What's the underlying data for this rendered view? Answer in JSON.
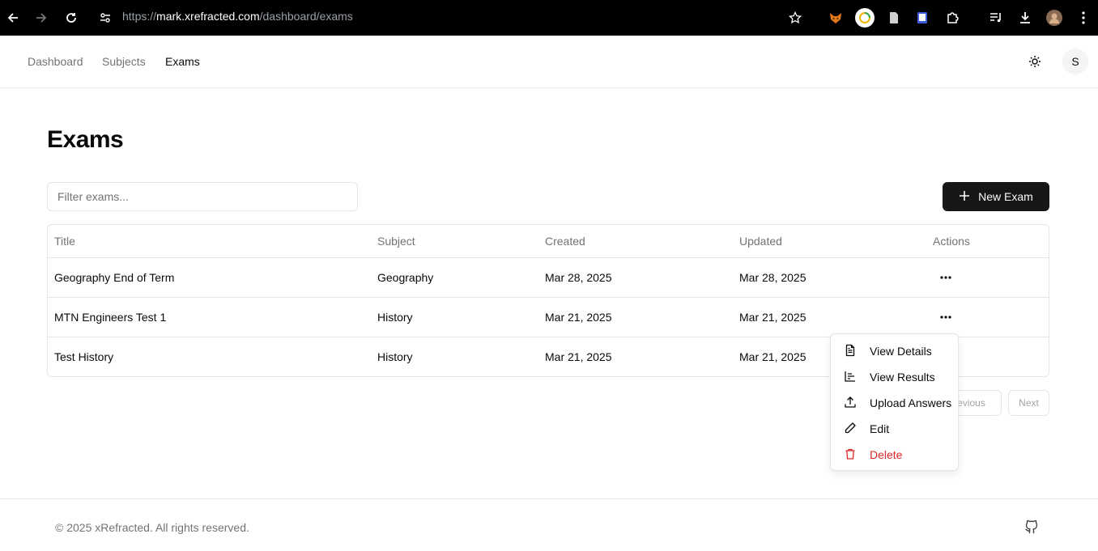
{
  "browser": {
    "url_prefix": "https://",
    "url_domain": "mark.xrefracted.com",
    "url_path": "/dashboard/exams"
  },
  "nav": {
    "links": [
      {
        "label": "Dashboard",
        "active": false
      },
      {
        "label": "Subjects",
        "active": false
      },
      {
        "label": "Exams",
        "active": true
      }
    ],
    "avatar_initial": "S"
  },
  "page": {
    "title": "Exams",
    "filter_placeholder": "Filter exams...",
    "new_button_label": "New Exam"
  },
  "table": {
    "headers": [
      "Title",
      "Subject",
      "Created",
      "Updated",
      "Actions"
    ],
    "rows": [
      {
        "title": "Geography End of Term",
        "subject": "Geography",
        "created": "Mar 28, 2025",
        "updated": "Mar 28, 2025"
      },
      {
        "title": "MTN Engineers Test 1",
        "subject": "History",
        "created": "Mar 21, 2025",
        "updated": "Mar 21, 2025"
      },
      {
        "title": "Test History",
        "subject": "History",
        "created": "Mar 21, 2025",
        "updated": "Mar 21, 2025"
      }
    ]
  },
  "pagination": {
    "previous_label": "Previous",
    "next_label": "Next"
  },
  "menu": {
    "items": [
      {
        "label": "View Details",
        "icon": "file-text-icon"
      },
      {
        "label": "View Results",
        "icon": "bar-chart-icon"
      },
      {
        "label": "Upload Answers",
        "icon": "upload-icon"
      },
      {
        "label": "Edit",
        "icon": "pencil-icon"
      },
      {
        "label": "Delete",
        "icon": "trash-icon"
      }
    ],
    "danger_color": "#dc2626"
  },
  "footer": {
    "copyright": "© 2025 xRefracted. All rights reserved."
  }
}
